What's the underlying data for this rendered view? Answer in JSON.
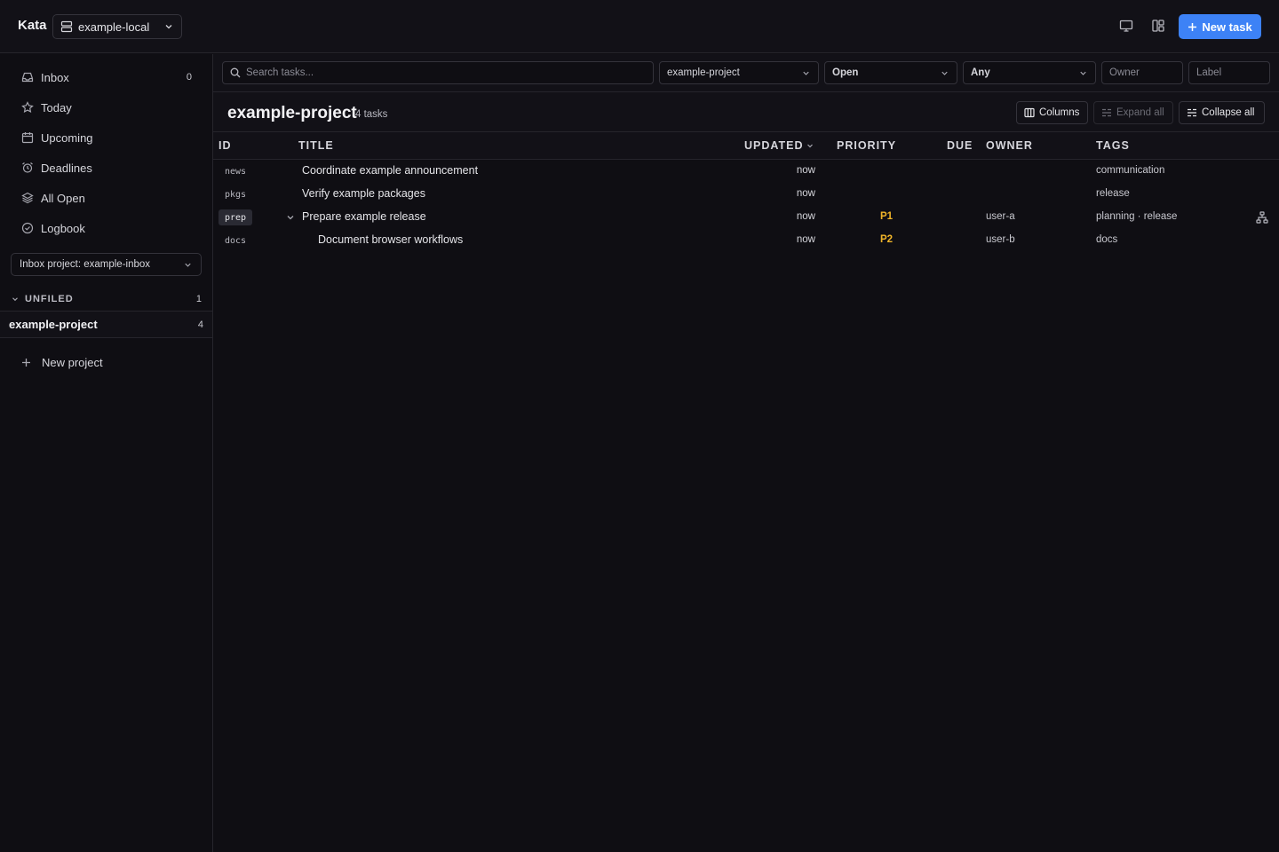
{
  "app": {
    "title": "Kata",
    "workspace": "example-local",
    "new_task_label": "New task",
    "accent": "#3d82f6"
  },
  "sidebar": {
    "nav": [
      {
        "label": "Inbox",
        "count": "0",
        "icon": "inbox-icon"
      },
      {
        "label": "Today",
        "icon": "star-icon"
      },
      {
        "label": "Upcoming",
        "icon": "calendar-icon"
      },
      {
        "label": "Deadlines",
        "icon": "alarm-icon"
      },
      {
        "label": "All Open",
        "icon": "layers-icon"
      },
      {
        "label": "Logbook",
        "icon": "check-circle-icon"
      }
    ],
    "inbox_project": "Inbox project: example-inbox",
    "group": {
      "label": "UNFILED",
      "count": "1"
    },
    "project": {
      "label": "example-project",
      "count": "4"
    },
    "new_project": "New project"
  },
  "filters": {
    "search_placeholder": "Search tasks...",
    "project": "example-project",
    "status": "Open",
    "priority": "Any",
    "owner_placeholder": "Owner",
    "label_placeholder": "Label"
  },
  "main": {
    "title": "example-project",
    "task_count": "4 tasks",
    "columns_btn": "Columns",
    "expand_btn": "Expand all",
    "collapse_btn": "Collapse all"
  },
  "table": {
    "headers": {
      "id": "ID",
      "title": "TITLE",
      "updated": "UPDATED",
      "priority": "PRIORITY",
      "due": "DUE",
      "owner": "OWNER",
      "tags": "TAGS"
    },
    "rows": [
      {
        "id": "news",
        "title": "Coordinate example announcement",
        "updated": "now",
        "priority": "",
        "owner": "",
        "tags": "communication"
      },
      {
        "id": "pkgs",
        "title": "Verify example packages",
        "updated": "now",
        "priority": "",
        "owner": "",
        "tags": "release"
      },
      {
        "id": "prep",
        "title": "Prepare example release",
        "updated": "now",
        "priority": "P1",
        "owner": "user-a",
        "tags": "planning · release"
      },
      {
        "id": "docs",
        "title": "Document browser workflows",
        "updated": "now",
        "priority": "P2",
        "owner": "user-b",
        "tags": "docs"
      }
    ]
  }
}
